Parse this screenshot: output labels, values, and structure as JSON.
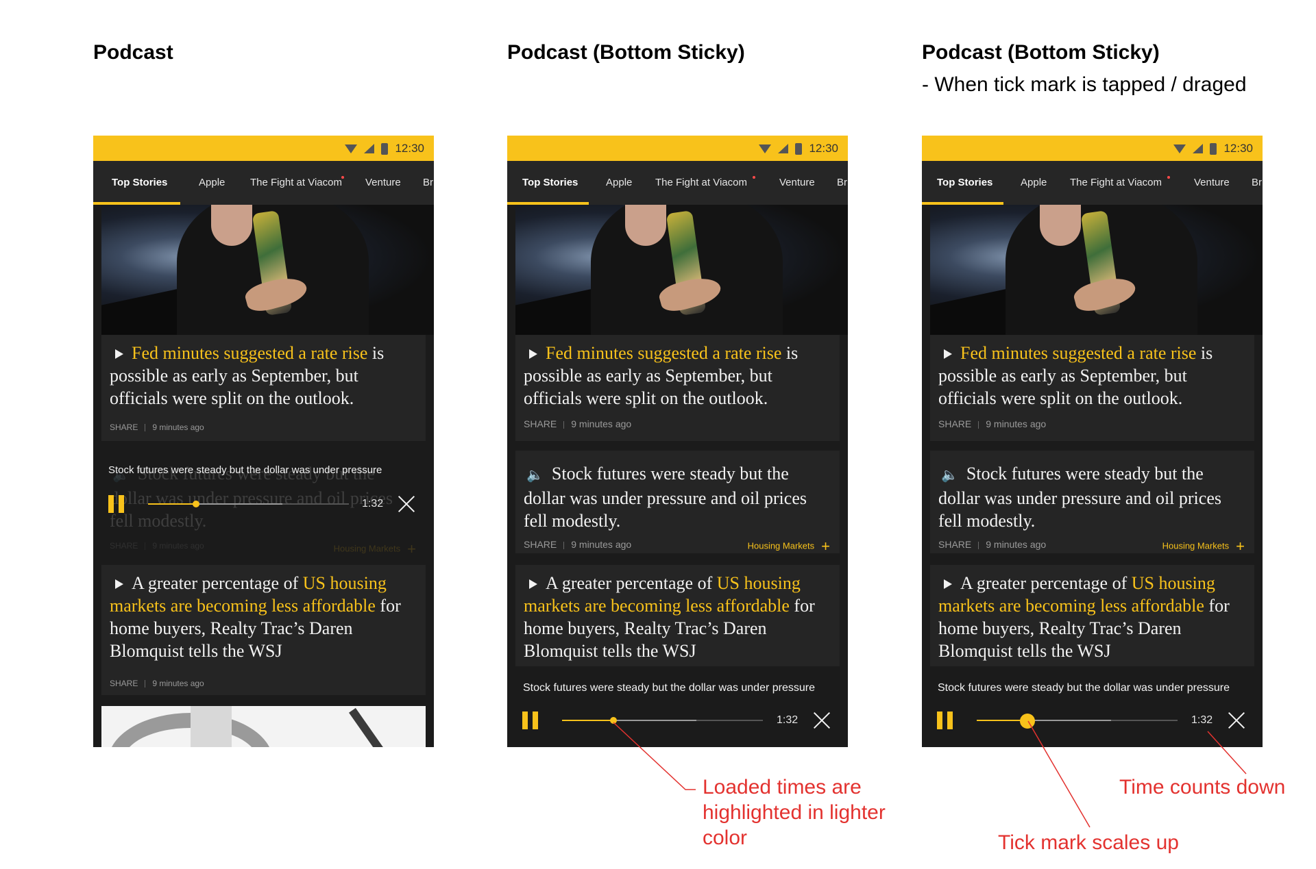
{
  "columns": [
    {
      "title": "Podcast",
      "subtitle": ""
    },
    {
      "title": "Podcast (Bottom Sticky)",
      "subtitle": ""
    },
    {
      "title": "Podcast (Bottom Sticky)",
      "subtitle": "- When tick mark is tapped / draged"
    }
  ],
  "status_bar": {
    "time": "12:30",
    "icons": [
      "wifi-icon",
      "signal-icon",
      "battery-icon"
    ]
  },
  "tabs": [
    "Top Stories",
    "Apple",
    "The Fight at Viacom",
    "Venture",
    "Br"
  ],
  "stories": [
    {
      "highlight": "Fed minutes suggested a rate rise",
      "rest": " is possible as early as September, but officials were split on the outlook.",
      "share": "SHARE",
      "time": "9 minutes ago"
    },
    {
      "text": "Stock futures were steady but the dollar was under pressure and oil prices fell modestly.",
      "share": "SHARE",
      "time": "9 minutes ago",
      "tag": "Housing Markets"
    },
    {
      "pre": "A greater percentage of ",
      "highlight": "US housing markets are becoming less affordable",
      "rest": " for home buyers, Realty Trac’s Daren Blomquist tells the WSJ",
      "share": "SHARE",
      "time": "9 minutes ago"
    }
  ],
  "player": {
    "title": "Stock futures were steady but the dollar was under pressure",
    "time": "1:32",
    "played_fraction": 0.25,
    "loaded_fraction": 0.67
  },
  "annotations": {
    "loaded": "Loaded times are highlighted in lighter color",
    "countdown": "Time counts down",
    "tick": "Tick mark scales up"
  },
  "colors": {
    "accent": "#f8c21b",
    "background": "#1b1b1b",
    "card": "#252525",
    "annotation": "#e3322f"
  }
}
